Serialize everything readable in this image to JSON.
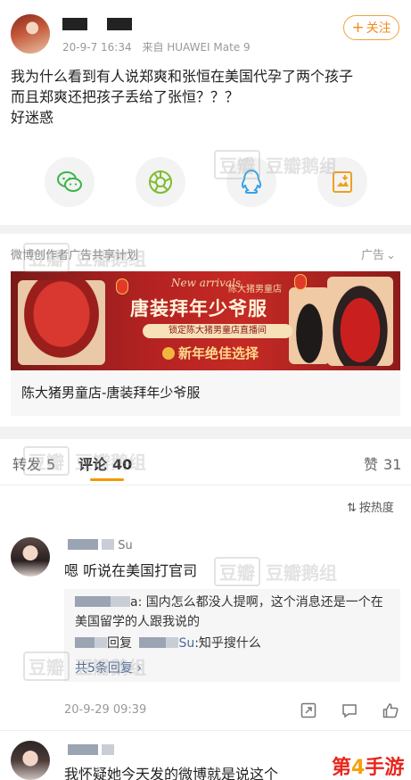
{
  "post": {
    "date": "20-9-7 16:34",
    "source": "来自 HUAWEI Mate 9",
    "follow_label": "关注",
    "follow_plus": "+",
    "text_lines": [
      "我为什么看到有人说郑爽和张恒在美国代孕了两个孩子",
      "而且郑爽还把孩子丢给了张恒？？？",
      "好迷惑"
    ]
  },
  "share_icons": [
    "wechat-icon",
    "moments-icon",
    "qq-icon",
    "save-image-icon"
  ],
  "ad": {
    "label": "微博创作者广告共享计划",
    "tag": "广告",
    "banner": {
      "script": "New arrivals",
      "shop": "陈大猪男童店",
      "headline": "唐装拜年少爷服",
      "locked": "锁定陈大猪男童店直播间",
      "pick": "新年绝佳选择"
    },
    "title": "陈大猪男童店-唐装拜年少爷服"
  },
  "tabs": {
    "repost_label": "转发",
    "repost_count": "5",
    "comment_label": "评论",
    "comment_count": "40",
    "likes_label": "赞",
    "likes_count": "31"
  },
  "sort_label": "按热度",
  "sort_icon": "sort-icon",
  "comments": [
    {
      "name_suffix": "Su",
      "text": "嗯 听说在美国打官司",
      "replies": [
        {
          "suffix": "a: 国内怎么都没人提啊，这个消息还是一个在"
        },
        {
          "text": "美国留学的人跟我说的"
        },
        {
          "reply_word": "回复",
          "target_suffix": "Su",
          "text": ":知乎搜什么"
        }
      ],
      "more_replies": "共5条回复",
      "time": "20-9-29 09:39"
    },
    {
      "text": "我怀疑她今天发的微博就是说这个"
    }
  ],
  "watermark": {
    "box": "豆瓣",
    "text": "豆瓣鹅组"
  },
  "footer_logo": {
    "prefix": "第",
    "digit": "4",
    "suffix": "手游"
  },
  "accent_color": "#f39800",
  "link_color": "#4a6a9a"
}
